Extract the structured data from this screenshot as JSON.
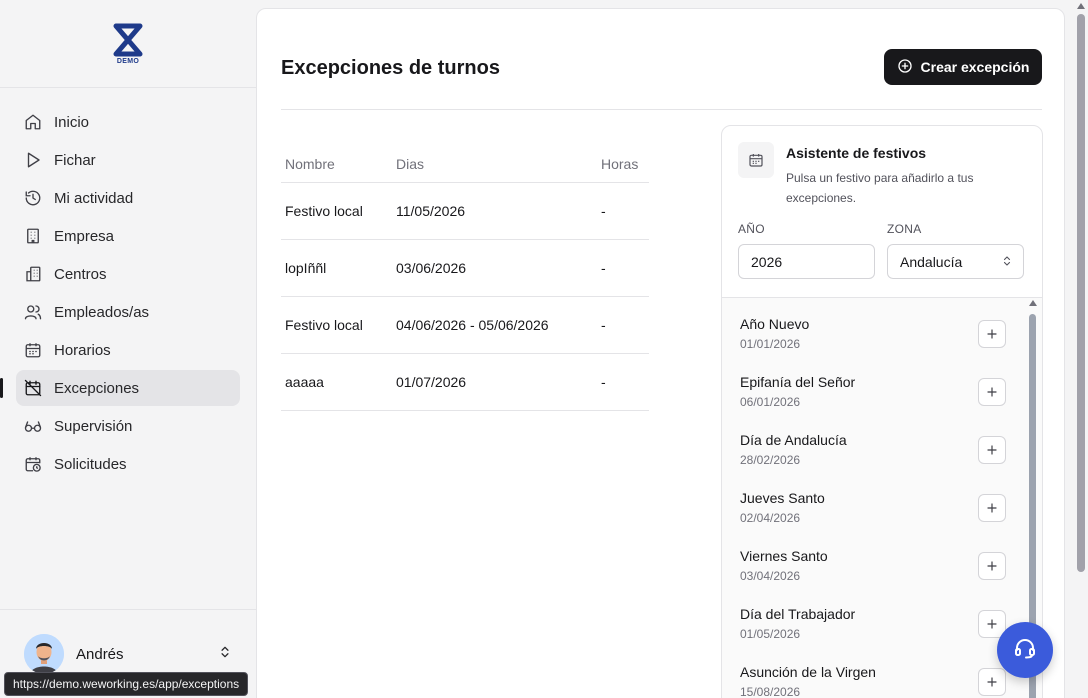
{
  "brand": {
    "logo_text": "DEMO"
  },
  "sidebar": {
    "items": [
      {
        "label": "Inicio",
        "icon": "home-icon"
      },
      {
        "label": "Fichar",
        "icon": "play-icon"
      },
      {
        "label": "Mi actividad",
        "icon": "history-icon"
      },
      {
        "label": "Empresa",
        "icon": "building-icon"
      },
      {
        "label": "Centros",
        "icon": "buildings-icon"
      },
      {
        "label": "Empleados/as",
        "icon": "users-icon"
      },
      {
        "label": "Horarios",
        "icon": "calendar-icon"
      },
      {
        "label": "Excepciones",
        "icon": "calendar-off-icon",
        "active": true
      },
      {
        "label": "Supervisión",
        "icon": "glasses-icon"
      },
      {
        "label": "Solicitudes",
        "icon": "calendar-clock-icon"
      }
    ],
    "user": {
      "name": "Andrés"
    },
    "status_url": "https://demo.weworking.es/app/exceptions"
  },
  "main": {
    "title": "Excepciones de turnos",
    "create_label": "Crear excepción",
    "table": {
      "headers": [
        "Nombre",
        "Dias",
        "Horas"
      ],
      "rows": [
        [
          "Festivo local",
          "11/05/2026",
          "-"
        ],
        [
          "lopIññl",
          "03/06/2026",
          "-"
        ],
        [
          "Festivo local",
          "04/06/2026 - 05/06/2026",
          "-"
        ],
        [
          "aaaaa",
          "01/07/2026",
          "-"
        ]
      ]
    }
  },
  "holidays": {
    "title": "Asistente de festivos",
    "description": "Pulsa un festivo para añadirlo a tus excepciones.",
    "year_label": "AÑO",
    "year_value": "2026",
    "zone_label": "ZONA",
    "zone_value": "Andalucía",
    "items": [
      {
        "name": "Año Nuevo",
        "date": "01/01/2026"
      },
      {
        "name": "Epifanía del Señor",
        "date": "06/01/2026"
      },
      {
        "name": "Día de Andalucía",
        "date": "28/02/2026"
      },
      {
        "name": "Jueves Santo",
        "date": "02/04/2026"
      },
      {
        "name": "Viernes Santo",
        "date": "03/04/2026"
      },
      {
        "name": "Día del Trabajador",
        "date": "01/05/2026"
      },
      {
        "name": "Asunción de la Virgen",
        "date": "15/08/2026"
      }
    ]
  },
  "colors": {
    "primary": "#18181b",
    "support": "#3b5bdb",
    "logo": "#1e3a8a"
  }
}
